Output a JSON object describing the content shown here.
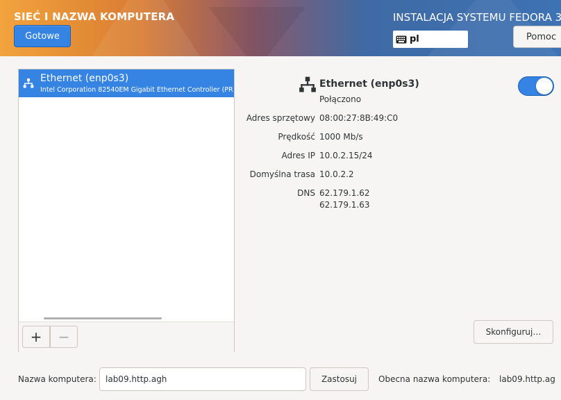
{
  "header": {
    "title": "SIEĆ I NAZWA KOMPUTERA",
    "done_label": "Gotowe",
    "install_title": "INSTALACJA SYSTEMU FEDORA 3",
    "keyboard_layout": "pl",
    "help_label": "Pomoc"
  },
  "devices": {
    "items": [
      {
        "name": "Ethernet (enp0s3)",
        "description": "Intel Corporation 82540EM Gigabit Ethernet Controller (PR",
        "icon": "network-wired-icon"
      }
    ],
    "add_symbol": "+",
    "remove_symbol": "−"
  },
  "detail": {
    "name": "Ethernet (enp0s3)",
    "status": "Połączono",
    "enabled": true,
    "properties": [
      {
        "label": "Adres sprzętowy",
        "value": "08:00:27:8B:49:C0"
      },
      {
        "label": "Prędkość",
        "value": "1000 Mb/s"
      },
      {
        "label": "Adres IP",
        "value": "10.0.2.15/24"
      },
      {
        "label": "Domyślna trasa",
        "value": "10.0.2.2"
      },
      {
        "label": "DNS",
        "value": "62.179.1.62",
        "value2": "62.179.1.63"
      }
    ],
    "configure_label": "Skonfiguruj…"
  },
  "hostname": {
    "label": "Nazwa komputera:",
    "value": "lab09.http.agh",
    "apply_label": "Zastosuj",
    "current_label": "Obecna nazwa komputera:",
    "current_value": "lab09.http.ag"
  },
  "colors": {
    "accent": "#3584e4",
    "background": "#f6f5f4"
  }
}
